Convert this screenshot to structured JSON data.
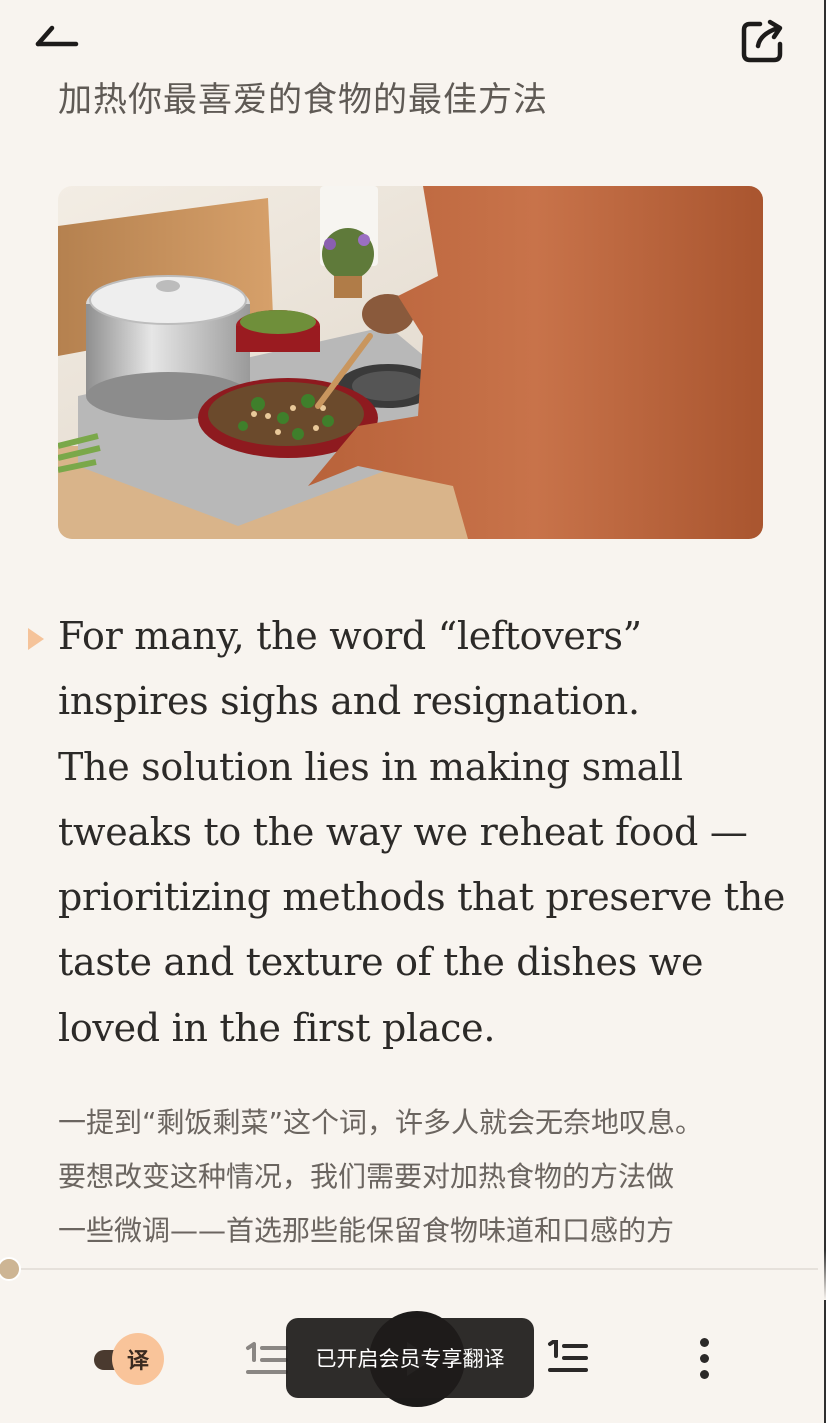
{
  "header": {
    "back_icon": "back-arrow-icon",
    "share_icon": "share-icon"
  },
  "article": {
    "subtitle": "加热你最喜爱的食物的最佳方法",
    "hero_image": "photo-person-stirring-pan-on-stove",
    "paragraph_en": [
      "For many, the word “leftovers”",
      "inspires sighs and resignation.",
      "The solution lies in making small",
      "tweaks to the way we reheat food —",
      "prioritizing methods that preserve the",
      "taste and texture of the dishes we",
      "loved in the first place."
    ],
    "paragraph_zh": [
      "一提到“剩饭剩菜”这个词，许多人就会无奈地叹息。",
      "要想改变这种情况，我们需要对加热食物的方法做",
      "一些微调——首选那些能保留食物味道和口感的方"
    ]
  },
  "bottom_bar": {
    "translate_label": "译",
    "translate_toggle_on": true,
    "toast": "已开启会员专享翻译",
    "more_icon": "more-vertical-icon"
  },
  "colors": {
    "background": "#f8f4ef",
    "accent": "#f9c49a",
    "text_primary": "#2c2a28",
    "text_secondary": "#6b6560"
  }
}
